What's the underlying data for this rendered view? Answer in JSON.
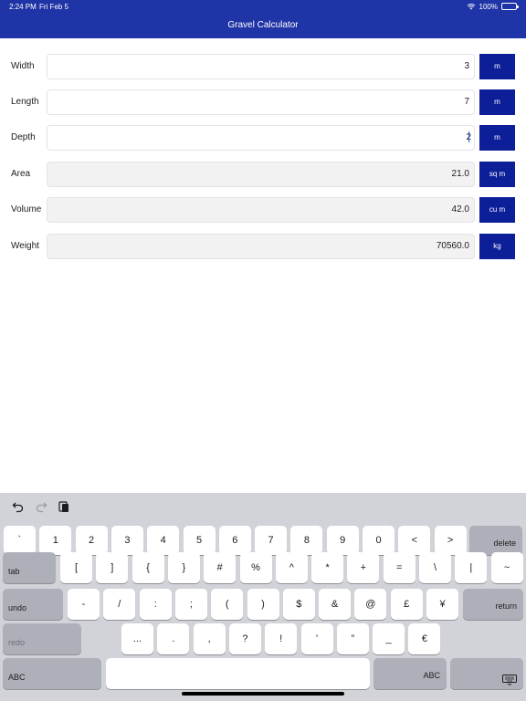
{
  "status": {
    "time": "2:24 PM",
    "date": "Fri Feb 5",
    "battery": "100%"
  },
  "nav": {
    "title": "Gravel Calculator"
  },
  "rows": [
    {
      "label": "Width",
      "value": "3",
      "unit": "m"
    },
    {
      "label": "Length",
      "value": "7",
      "unit": "m"
    },
    {
      "label": "Depth",
      "value": "2",
      "unit": "m"
    },
    {
      "label": "Area",
      "value": "21.0",
      "unit": "sq m"
    },
    {
      "label": "Volume",
      "value": "42.0",
      "unit": "cu m"
    },
    {
      "label": "Weight",
      "value": "70560.0",
      "unit": "kg"
    }
  ],
  "keyboard": {
    "toolbar_icons": [
      "undo-icon",
      "redo-icon",
      "paste-icon"
    ],
    "row1": [
      "`",
      "1",
      "2",
      "3",
      "4",
      "5",
      "6",
      "7",
      "8",
      "9",
      "0",
      "<",
      ">"
    ],
    "delete": "delete",
    "tab": "tab",
    "row2": [
      "[",
      "]",
      "{",
      "}",
      "#",
      "%",
      "^",
      "*",
      "+",
      "=",
      "\\",
      "|",
      "~"
    ],
    "undo": "undo",
    "row3": [
      "-",
      "/",
      ":",
      ";",
      "(",
      ")",
      "$",
      "&",
      "@",
      "£",
      "¥"
    ],
    "return": "return",
    "redo": "redo",
    "row4": [
      "...",
      ".",
      ",",
      "?",
      "!",
      "’",
      "”",
      "_",
      "€"
    ],
    "abc_left": "ABC",
    "abc_right": "ABC",
    "dismiss_icon": "keyboard-dismiss-icon"
  },
  "colors": {
    "nav_bar": "#1f34a6",
    "unit_button": "#0d1f98",
    "keyboard_bg": "#d1d3d9"
  }
}
